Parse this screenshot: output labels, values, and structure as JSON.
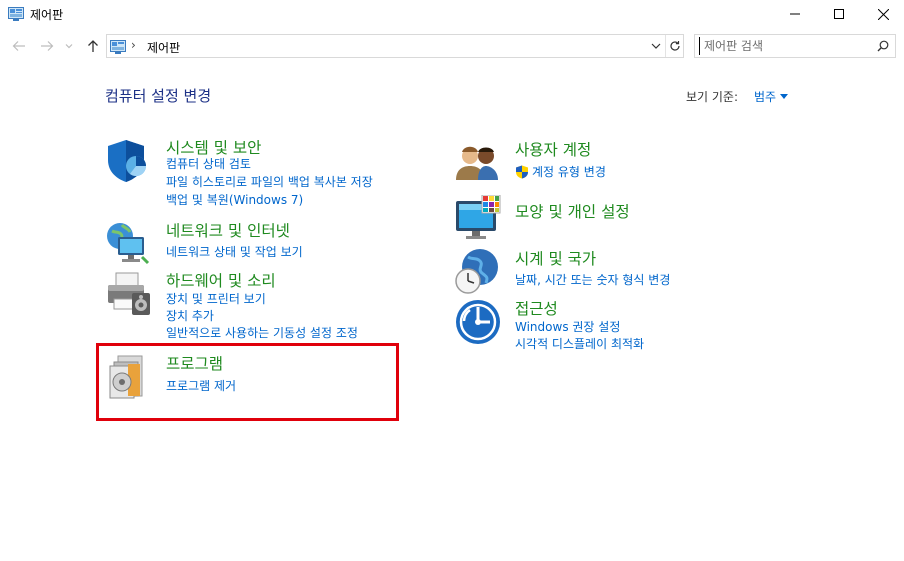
{
  "window": {
    "title": "제어판"
  },
  "address": {
    "path": "제어판"
  },
  "search": {
    "placeholder": "제어판 검색"
  },
  "header": {
    "title": "컴퓨터 설정 변경",
    "view_by_label": "보기 기준:",
    "view_by_value": "범주"
  },
  "categories": [
    {
      "title": "시스템 및 보안",
      "icon": "shield-icon",
      "links": [
        "컴퓨터 상태 검토",
        "파일 히스토리로 파일의 백업 복사본 저장",
        "백업 및 복원(Windows 7)"
      ]
    },
    {
      "title": "네트워크 및 인터넷",
      "icon": "network-icon",
      "links": [
        "네트워크 상태 및 작업 보기"
      ]
    },
    {
      "title": "하드웨어 및 소리",
      "icon": "printer-icon",
      "links": [
        "장치 및 프린터 보기",
        "장치 추가",
        "일반적으로 사용하는 기동성 설정 조정"
      ]
    },
    {
      "title": "프로그램",
      "icon": "programs-icon",
      "links": [
        "프로그램 제거"
      ]
    },
    {
      "title": "사용자 계정",
      "icon": "users-icon",
      "links": [
        "계정 유형 변경"
      ]
    },
    {
      "title": "모양 및 개인 설정",
      "icon": "monitor-icon",
      "links": []
    },
    {
      "title": "시계 및 국가",
      "icon": "clock-globe-icon",
      "links": [
        "날짜, 시간 또는 숫자 형식 변경"
      ]
    },
    {
      "title": "접근성",
      "icon": "accessibility-icon",
      "links": [
        "Windows 권장 설정",
        "시각적 디스플레이 최적화"
      ]
    }
  ],
  "colors": {
    "category_title": "#1f8a1f",
    "link": "#0066cc",
    "page_title": "#1e3287",
    "highlight": "#e0000b"
  }
}
